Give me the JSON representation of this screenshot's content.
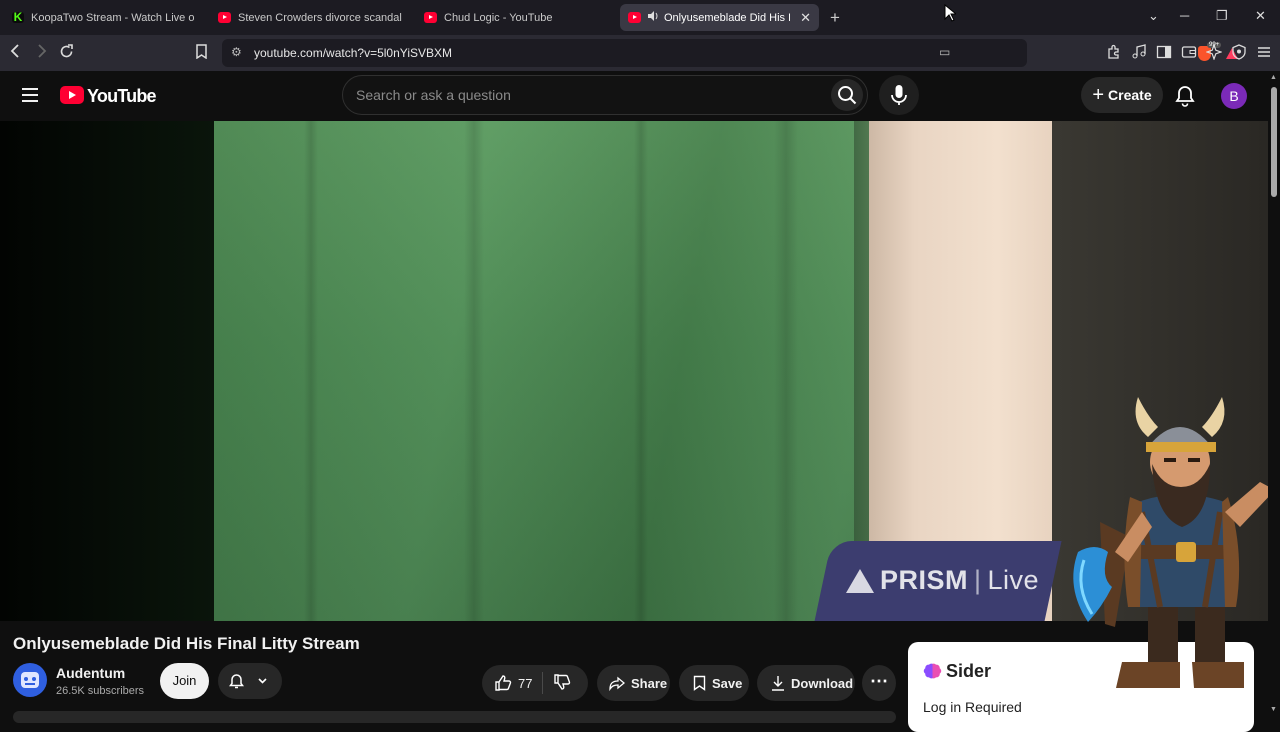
{
  "browser": {
    "tabs": [
      {
        "title": "KoopaTwo Stream - Watch Live o",
        "icon": "kick-icon",
        "active": false
      },
      {
        "title": "Steven Crowders divorce scandal | RE",
        "icon": "youtube-icon",
        "active": false
      },
      {
        "title": "Chud Logic - YouTube",
        "icon": "youtube-icon",
        "active": false
      },
      {
        "title": "Onlyusemeblade Did His Fina",
        "icon": "youtube-icon",
        "active": true,
        "audio": true
      }
    ],
    "url": "youtube.com/watch?v=5l0nYiSVBXM",
    "shield_badge": "99+"
  },
  "youtube": {
    "logo_text": "YouTube",
    "search_placeholder": "Search or ask a question",
    "create_label": "Create",
    "avatar_letter": "B"
  },
  "video": {
    "watermark_brand": "PRISM",
    "watermark_live": "Live",
    "title": "Onlyusemeblade Did His Final Litty Stream"
  },
  "channel": {
    "name": "Audentum",
    "subscribers": "26.5K subscribers",
    "join_label": "Join"
  },
  "actions": {
    "likes": "77",
    "share": "Share",
    "save": "Save",
    "download": "Download"
  },
  "sider": {
    "name": "Sider",
    "message": "Log in Required"
  },
  "colors": {
    "youtube_red": "#ff0033",
    "sider_purple": "#8b4dff",
    "avatar_purple": "#7b2ab8"
  }
}
